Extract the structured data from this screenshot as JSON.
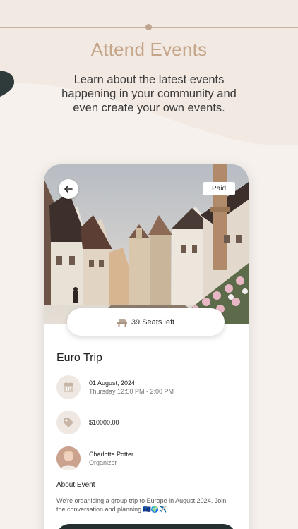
{
  "header": {
    "title": "Attend Events",
    "subtitle": "Learn about the latest events happening in your community and even create your own events."
  },
  "event": {
    "badge": "Paid",
    "seats": "39 Seats left",
    "title": "Euro Trip",
    "date": "01 August, 2024",
    "time": "Thursday 12:50 PM - 2:00 PM",
    "price": "$10000.00",
    "organizer_name": "Charlotte Potter",
    "organizer_role": "Organizer",
    "about_heading": "About Event",
    "about_text": "We're organising a group trip to Europe in August 2024. Join the conversation and planning 🇪🇺🌍✈️"
  },
  "icons": {
    "back": "arrow-left-icon",
    "seat": "seat-icon",
    "calendar": "calendar-icon",
    "price": "tag-icon"
  },
  "colors": {
    "background": "#f6f1ed",
    "accent": "#c5a68b",
    "icon_bg": "#efe8e2",
    "cta": "#24302f"
  }
}
